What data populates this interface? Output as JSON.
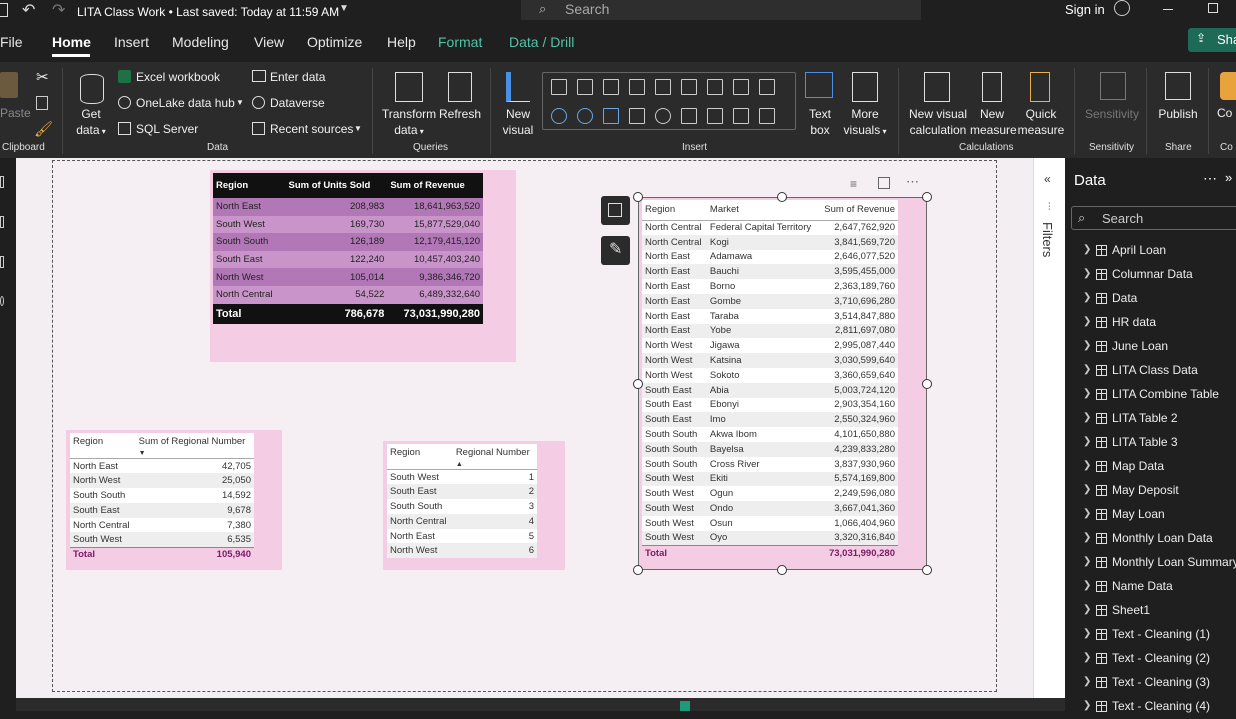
{
  "titlebar": {
    "title": "LITA Class Work • Last saved: Today at 11:59 AM",
    "search_placeholder": "Search",
    "signin": "Sign in"
  },
  "tabs": [
    "File",
    "Home",
    "Insert",
    "Modeling",
    "View",
    "Optimize",
    "Help",
    "Format",
    "Data / Drill"
  ],
  "share_label": "Sha",
  "ribbon": {
    "clipboard": {
      "paste": "Paste",
      "label": "Clipboard"
    },
    "data": {
      "get_data": "Get",
      "get_data2": "data",
      "excel": "Excel workbook",
      "onelake": "OneLake data hub",
      "sql": "SQL Server",
      "enter": "Enter data",
      "dataverse": "Dataverse",
      "recent": "Recent sources",
      "label": "Data"
    },
    "queries": {
      "transform": "Transform",
      "transform2": "data",
      "refresh": "Refresh",
      "label": "Queries"
    },
    "insert": {
      "new_visual": "New",
      "new_visual2": "visual",
      "text_box": "Text",
      "text_box2": "box",
      "more_visuals": "More",
      "more_visuals2": "visuals",
      "label": "Insert"
    },
    "calculations": {
      "nvc": "New visual",
      "nvc2": "calculation",
      "nm": "New",
      "nm2": "measure",
      "qm": "Quick",
      "qm2": "measure",
      "label": "Calculations"
    },
    "sensitivity": {
      "btn": "Sensitivity",
      "label": "Sensitivity"
    },
    "share": {
      "publish": "Publish",
      "label": "Share"
    },
    "co": {
      "btn": "Co",
      "label": "Co"
    }
  },
  "table1": {
    "headers": [
      "Region",
      "Sum of Units Sold",
      "Sum of Revenue"
    ],
    "rows": [
      [
        "North East",
        "208,983",
        "18,641,963,520"
      ],
      [
        "South West",
        "169,730",
        "15,877,529,040"
      ],
      [
        "South South",
        "126,189",
        "12,179,415,120"
      ],
      [
        "South East",
        "122,240",
        "10,457,403,240"
      ],
      [
        "North West",
        "105,014",
        "9,386,346,720"
      ],
      [
        "North Central",
        "54,522",
        "6,489,332,640"
      ]
    ],
    "total": [
      "Total",
      "786,678",
      "73,031,990,280"
    ]
  },
  "table2": {
    "headers": [
      "Region",
      "Sum of Regional Number"
    ],
    "rows": [
      [
        "North East",
        "42,705"
      ],
      [
        "North West",
        "25,050"
      ],
      [
        "South South",
        "14,592"
      ],
      [
        "South East",
        "9,678"
      ],
      [
        "North Central",
        "7,380"
      ],
      [
        "South West",
        "6,535"
      ]
    ],
    "total": [
      "Total",
      "105,940"
    ]
  },
  "table3": {
    "headers": [
      "Region",
      "Regional Number"
    ],
    "rows": [
      [
        "South West",
        "1"
      ],
      [
        "South East",
        "2"
      ],
      [
        "South South",
        "3"
      ],
      [
        "North Central",
        "4"
      ],
      [
        "North East",
        "5"
      ],
      [
        "North West",
        "6"
      ]
    ]
  },
  "table4": {
    "headers": [
      "Region",
      "Market",
      "Sum of Revenue"
    ],
    "rows": [
      [
        "North Central",
        "Federal Capital Territory",
        "2,647,762,920"
      ],
      [
        "North Central",
        "Kogi",
        "3,841,569,720"
      ],
      [
        "North East",
        "Adamawa",
        "2,646,077,520"
      ],
      [
        "North East",
        "Bauchi",
        "3,595,455,000"
      ],
      [
        "North East",
        "Borno",
        "2,363,189,760"
      ],
      [
        "North East",
        "Gombe",
        "3,710,696,280"
      ],
      [
        "North East",
        "Taraba",
        "3,514,847,880"
      ],
      [
        "North East",
        "Yobe",
        "2,811,697,080"
      ],
      [
        "North West",
        "Jigawa",
        "2,995,087,440"
      ],
      [
        "North West",
        "Katsina",
        "3,030,599,640"
      ],
      [
        "North West",
        "Sokoto",
        "3,360,659,640"
      ],
      [
        "South East",
        "Abia",
        "5,003,724,120"
      ],
      [
        "South East",
        "Ebonyi",
        "2,903,354,160"
      ],
      [
        "South East",
        "Imo",
        "2,550,324,960"
      ],
      [
        "South South",
        "Akwa Ibom",
        "4,101,650,880"
      ],
      [
        "South South",
        "Bayelsa",
        "4,239,833,280"
      ],
      [
        "South South",
        "Cross River",
        "3,837,930,960"
      ],
      [
        "South West",
        "Ekiti",
        "5,574,169,800"
      ],
      [
        "South West",
        "Ogun",
        "2,249,596,080"
      ],
      [
        "South West",
        "Ondo",
        "3,667,041,360"
      ],
      [
        "South West",
        "Osun",
        "1,066,404,960"
      ],
      [
        "South West",
        "Oyo",
        "3,320,316,840"
      ]
    ],
    "total": [
      "Total",
      "",
      "73,031,990,280"
    ]
  },
  "filters_label": "Filters",
  "datapane": {
    "title": "Data",
    "search_placeholder": "Search",
    "items": [
      "April Loan",
      "Columnar Data",
      "Data",
      "HR data",
      "June Loan",
      "LITA Class Data",
      "LITA Combine Table",
      "LITA Table 2",
      "LITA Table 3",
      "Map Data",
      "May Deposit",
      "May Loan",
      "Monthly Loan Data",
      "Monthly Loan Summary",
      "Name Data",
      "Sheet1",
      "Text - Cleaning (1)",
      "Text - Cleaning (2)",
      "Text - Cleaning (3)",
      "Text - Cleaning (4)"
    ]
  }
}
